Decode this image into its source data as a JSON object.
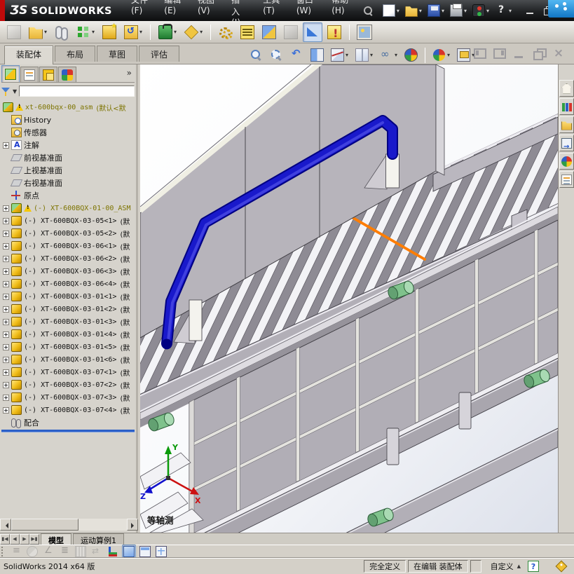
{
  "titlebar": {
    "logo_mark": "ƷS",
    "logo_text": "SOLIDWORKS",
    "menus": [
      {
        "label": "文件(F)"
      },
      {
        "label": "编辑(E)"
      },
      {
        "label": "视图(V)"
      },
      {
        "label": "插入(I)"
      },
      {
        "label": "工具(T)"
      },
      {
        "label": "窗口(W)"
      },
      {
        "label": "帮助(H)"
      }
    ],
    "quick_icons": [
      {
        "icon": "new",
        "dd": true
      },
      {
        "icon": "open",
        "dd": true
      },
      {
        "icon": "save",
        "dd": true
      },
      {
        "icon": "print",
        "dd": true
      },
      {
        "icon": "options",
        "dd": true
      },
      {
        "icon": "help",
        "dd": true
      }
    ]
  },
  "assembly_toolbar": {
    "icons": [
      {
        "icon": "insert-component",
        "state": "disabled"
      },
      {
        "icon": "open-part",
        "dd": true
      },
      {
        "icon": "mate"
      },
      {
        "icon": "component-pattern",
        "dd": true
      },
      {
        "icon": "smart-fasteners"
      },
      {
        "icon": "move-component",
        "dd": true
      },
      {
        "sep": true
      },
      {
        "icon": "assembly-features",
        "dd": true
      },
      {
        "icon": "reference-geometry",
        "dd": true
      },
      {
        "sep": true
      },
      {
        "icon": "motion-gears"
      },
      {
        "icon": "bill-of-materials"
      },
      {
        "icon": "exploded-view"
      },
      {
        "icon": "explode-line-sketch",
        "state": "disabled"
      },
      {
        "icon": "instant3d",
        "state": "pressed"
      },
      {
        "icon": "update-holders"
      },
      {
        "sep": true
      },
      {
        "icon": "screen-capture"
      }
    ]
  },
  "command_tabs": [
    {
      "label": "装配体",
      "active": true
    },
    {
      "label": "布局"
    },
    {
      "label": "草图"
    },
    {
      "label": "评估"
    }
  ],
  "headsup": {
    "icons": [
      {
        "icon": "zoom-fit"
      },
      {
        "icon": "zoom-area"
      },
      {
        "icon": "previous-view"
      },
      {
        "icon": "section-view"
      },
      {
        "icon": "view-orientation",
        "dd": true
      },
      {
        "icon": "display-style",
        "dd": true
      },
      {
        "icon": "hide-show",
        "dd": true
      },
      {
        "icon": "edit-appearance"
      },
      {
        "sep": true
      },
      {
        "icon": "scene",
        "dd": true
      },
      {
        "icon": "view-settings",
        "dd": true
      }
    ]
  },
  "feature_panel": {
    "header_icons": [
      {
        "icon": "fm-tree",
        "state": "pressed"
      },
      {
        "icon": "prop-mgr"
      },
      {
        "icon": "cfg-mgr"
      },
      {
        "icon": "disp-mgr"
      }
    ],
    "chevron": "»",
    "filter_placeholder": "",
    "tree": {
      "root": {
        "name": "xt-600bqx-00_asm",
        "suffix": "(默认<默",
        "warn": true
      },
      "items": [
        {
          "icon": "history",
          "label": "History"
        },
        {
          "icon": "sensors",
          "label": "传感器"
        },
        {
          "icon": "annotations",
          "label": "注解",
          "expand": true
        },
        {
          "icon": "plane",
          "label": "前视基准面"
        },
        {
          "icon": "plane",
          "label": "上视基准面"
        },
        {
          "icon": "plane",
          "label": "右视基准面"
        },
        {
          "icon": "origin",
          "label": "原点"
        }
      ],
      "components": [
        {
          "icon": "asm",
          "label": "(-) XT-600BQX-01-00_ASM",
          "suffix": "",
          "expand": true,
          "warn": true,
          "cls": "olive"
        },
        {
          "icon": "part",
          "label": "(-) XT-600BQX-03-05<1>",
          "suffix": "(默",
          "expand": true
        },
        {
          "icon": "part",
          "label": "(-) XT-600BQX-03-05<2>",
          "suffix": "(默",
          "expand": true
        },
        {
          "icon": "part",
          "label": "(-) XT-600BQX-03-06<1>",
          "suffix": "(默",
          "expand": true
        },
        {
          "icon": "part",
          "label": "(-) XT-600BQX-03-06<2>",
          "suffix": "(默",
          "expand": true
        },
        {
          "icon": "part",
          "label": "(-) XT-600BQX-03-06<3>",
          "suffix": "(默",
          "expand": true
        },
        {
          "icon": "part",
          "label": "(-) XT-600BQX-03-06<4>",
          "suffix": "(默",
          "expand": true
        },
        {
          "icon": "part",
          "label": "(-) XT-600BQX-03-01<1>",
          "suffix": "(默",
          "expand": true
        },
        {
          "icon": "part",
          "label": "(-) XT-600BQX-03-01<2>",
          "suffix": "(默",
          "expand": true
        },
        {
          "icon": "part",
          "label": "(-) XT-600BQX-03-01<3>",
          "suffix": "(默",
          "expand": true
        },
        {
          "icon": "part",
          "label": "(-) XT-600BQX-03-01<4>",
          "suffix": "(默",
          "expand": true
        },
        {
          "icon": "part",
          "label": "(-) XT-600BQX-03-01<5>",
          "suffix": "(默",
          "expand": true
        },
        {
          "icon": "part",
          "label": "(-) XT-600BQX-03-01<6>",
          "suffix": "(默",
          "expand": true
        },
        {
          "icon": "part",
          "label": "(-) XT-600BQX-03-07<1>",
          "suffix": "(默",
          "expand": true
        },
        {
          "icon": "part",
          "label": "(-) XT-600BQX-03-07<2>",
          "suffix": "(默",
          "expand": true
        },
        {
          "icon": "part",
          "label": "(-) XT-600BQX-03-07<3>",
          "suffix": "(默",
          "expand": true
        },
        {
          "icon": "part",
          "label": "(-) XT-600BQX-03-07<4>",
          "suffix": "(默",
          "expand": true
        }
      ],
      "mates_label": "配合"
    }
  },
  "task_pane": {
    "icons": [
      {
        "icon": "resources"
      },
      {
        "icon": "design-library"
      },
      {
        "icon": "file-explorer"
      },
      {
        "icon": "view-palette"
      },
      {
        "icon": "appearances"
      },
      {
        "icon": "custom-properties"
      }
    ]
  },
  "graphics": {
    "view_label": "等轴测",
    "triad": {
      "x": "X",
      "y": "Y",
      "z": "Z"
    }
  },
  "model_tabs": {
    "nav": [
      {
        "glyph": "▮◀"
      },
      {
        "glyph": "◀"
      },
      {
        "glyph": "▶"
      },
      {
        "glyph": "▶▮"
      }
    ],
    "tabs": [
      {
        "label": "模型",
        "active": true
      },
      {
        "label": "运动算例1"
      }
    ]
  },
  "view_toolbar": {
    "icons": [
      {
        "icon": "mass-props",
        "state": "disabled"
      },
      {
        "icon": "section-tool",
        "state": "disabled"
      },
      {
        "icon": "measure-tool",
        "state": "disabled"
      },
      {
        "icon": "appearance-bars",
        "state": "disabled"
      },
      {
        "icon": "dims",
        "state": "disabled"
      },
      {
        "icon": "compare",
        "state": "disabled"
      },
      {
        "icon": "axes-tool"
      },
      {
        "icon": "shaded-view",
        "state": "pressed"
      },
      {
        "icon": "split-view"
      },
      {
        "icon": "grid-view"
      }
    ]
  },
  "statusbar": {
    "app_version": "SolidWorks 2014 x64 版",
    "define_state": "完全定义",
    "editing_state": "在编辑 装配体",
    "custom_label": "自定义",
    "help_glyph": "?"
  },
  "colors": {
    "selection_orange": "#ff7d00",
    "pipe_blue": "#1919cb",
    "knob_green": "#7fc28c",
    "rollback_blue": "#2b5fc7",
    "tree_olive": "#7d7400"
  }
}
